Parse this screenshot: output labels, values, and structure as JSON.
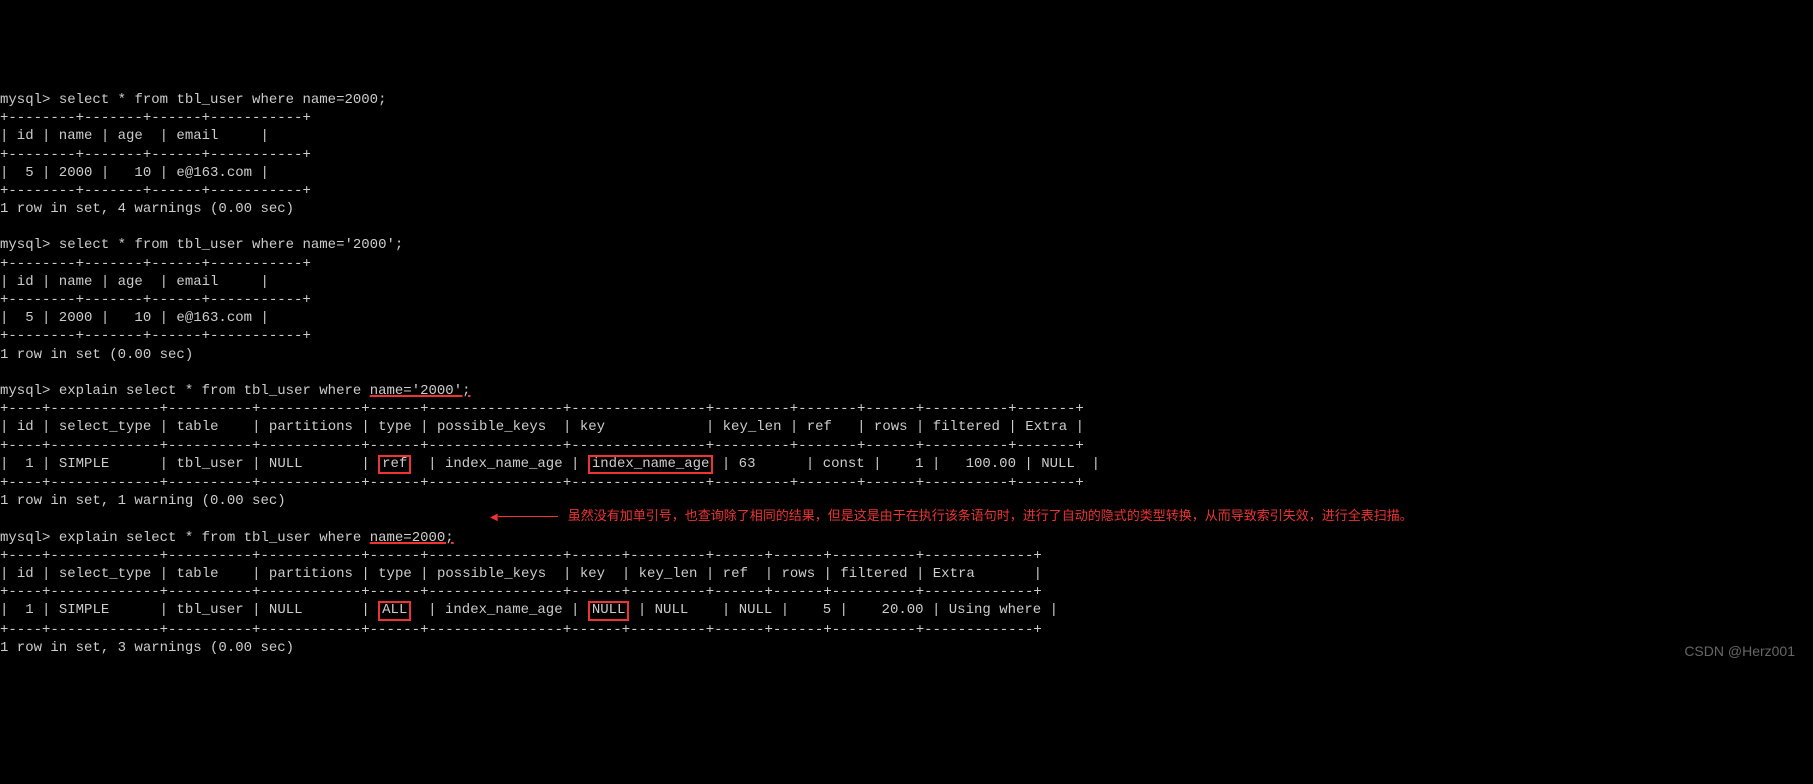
{
  "prompt": "mysql>",
  "queries": {
    "q1": "select * from tbl_user where name=2000;",
    "q2": "select * from tbl_user where name='2000';",
    "q3_pre": "explain select * from tbl_user where ",
    "q3_cond": "name='2000';",
    "q4_pre": "explain select * from tbl_user where ",
    "q4_cond": "name=2000;"
  },
  "small_table": {
    "border_top": "+--------+-------+------+-----------+",
    "border_sep": "+--------+-------+------+-----------+",
    "header": "| id | name | age  | email     |",
    "row": "|  5 | 2000 |   10 | e@163.com |"
  },
  "status": {
    "s1": "1 row in set, 4 warnings (0.00 sec)",
    "s2": "1 row in set (0.00 sec)",
    "s3": "1 row in set, 1 warning (0.00 sec)",
    "s4": "1 row in set, 3 warnings (0.00 sec)"
  },
  "explain1": {
    "headers": [
      "id",
      "select_type",
      "table",
      "partitions",
      "type",
      "possible_keys",
      "key",
      "key_len",
      "ref",
      "rows",
      "filtered",
      "Extra"
    ],
    "row": {
      "id": "1",
      "select_type": "SIMPLE",
      "table": "tbl_user",
      "partitions": "NULL",
      "type": "ref",
      "possible_keys": "index_name_age",
      "key": "index_name_age",
      "key_len": "63",
      "ref": "const",
      "rows": "1",
      "filtered": "100.00",
      "Extra": "NULL"
    }
  },
  "explain2": {
    "headers": [
      "id",
      "select_type",
      "table",
      "partitions",
      "type",
      "possible_keys",
      "key",
      "key_len",
      "ref",
      "rows",
      "filtered",
      "Extra"
    ],
    "row": {
      "id": "1",
      "select_type": "SIMPLE",
      "table": "tbl_user",
      "partitions": "NULL",
      "type": "ALL",
      "possible_keys": "index_name_age",
      "key": "NULL",
      "key_len": "NULL",
      "ref": "NULL",
      "rows": "5",
      "filtered": "20.00",
      "Extra": "Using where"
    }
  },
  "annotation": "虽然没有加单引号，也查询除了相同的结果，但是这是由于在执行该条语句时，进行了自动的隐式的类型转换，从而导致索引失效，进行全表扫描。",
  "watermark": "CSDN @Herz001"
}
